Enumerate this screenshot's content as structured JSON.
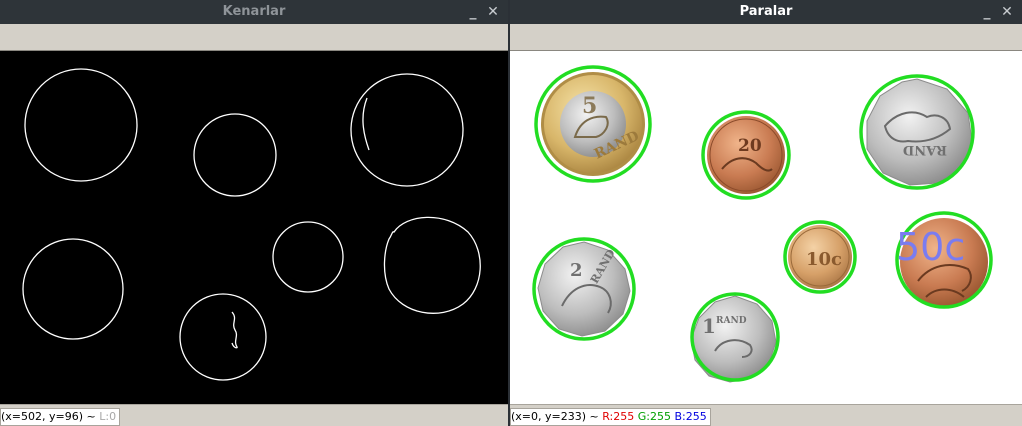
{
  "windows": {
    "left": {
      "title": "Kenarlar",
      "minimize_glyph": "_",
      "close_glyph": "✕",
      "status": {
        "coords": "(x=502, y=96)",
        "sep": " ~ ",
        "level": "L:0"
      }
    },
    "right": {
      "title": "Paralar",
      "minimize_glyph": "_",
      "close_glyph": "✕",
      "status": {
        "coords": "(x=0, y=233)",
        "sep": " ~ ",
        "r": "R:255",
        "g": "G:255",
        "b": "B:255"
      },
      "overlay_label": "50c"
    }
  },
  "colors": {
    "titlebar": "#2e3439",
    "detection_circle": "#22dd22",
    "overlay_label": "#7a7cf0",
    "edge_lines": "#ffffff"
  },
  "image_content": {
    "edges": [
      "edge-circle-1",
      "edge-circle-2",
      "edge-circle-3",
      "edge-circle-4",
      "edge-circle-5",
      "edge-circle-6",
      "edge-circle-7"
    ],
    "coins": [
      {
        "name": "coin-5-rand",
        "text": "RAND"
      },
      {
        "name": "coin-20c",
        "text": "20"
      },
      {
        "name": "coin-2-rand-top",
        "text": "RAND"
      },
      {
        "name": "coin-2-rand",
        "text": "RAND"
      },
      {
        "name": "coin-10c",
        "text": "10c"
      },
      {
        "name": "coin-50c",
        "text": "50c"
      },
      {
        "name": "coin-1-rand",
        "text": "1 RAND"
      }
    ]
  }
}
